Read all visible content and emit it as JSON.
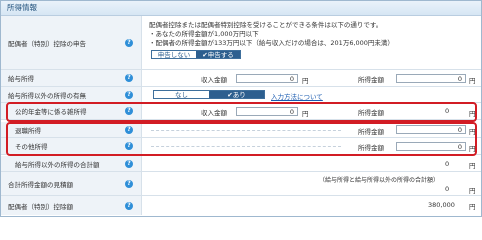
{
  "section_title": "所得情報",
  "spouse_deduction": {
    "label": "配偶者（特別）控除の申告",
    "note": {
      "line1": "配偶者控除または配偶者特別控除を受けることができる条件は以下の通りです。",
      "line2": "・あなたの所得金額が1,000万円以下",
      "line3": "・配偶者の所得金額が133万円以下（給与収入だけの場合は、201万6,000円未満）"
    },
    "toggle_off": "申告しない",
    "toggle_on": "申告する"
  },
  "salary_income": {
    "label": "給与所得",
    "revenue_label": "収入金額",
    "revenue_value": "0",
    "income_label": "所得金額",
    "income_value": "0",
    "unit": "円"
  },
  "other_income_flag": {
    "label": "給与所得以外の所得の有無",
    "opt_none": "なし",
    "opt_some": "あり",
    "link": "入力方法について"
  },
  "pension_income": {
    "label": "公的年金等に係る雑所得",
    "revenue_label": "収入金額",
    "revenue_value": "0",
    "income_label": "所得金額",
    "income_value": "0",
    "unit": "円"
  },
  "retirement_income": {
    "label": "退職所得",
    "income_label": "所得金額",
    "income_value": "0",
    "unit": "円"
  },
  "other_income": {
    "label": "その他所得",
    "income_label": "所得金額",
    "income_value": "0",
    "unit": "円"
  },
  "non_salary_total": {
    "label": "給与所得以外の所得の合計額",
    "value": "0",
    "unit": "円"
  },
  "total_estimate": {
    "label": "合計所得金額の見積額",
    "note": "（給与所得と給与所得以外の所得の合計額）",
    "value": "0",
    "unit": "円"
  },
  "spouse_deduction_amount": {
    "label": "配偶者（特別）控除額",
    "value": "380,000",
    "unit": "円"
  },
  "help_glyph": "?"
}
